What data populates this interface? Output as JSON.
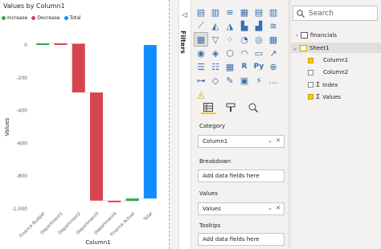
{
  "visual": {
    "title": "Values by Column1",
    "legend": [
      {
        "label": "Increase",
        "color": "#2ea84a"
      },
      {
        "label": "Decrease",
        "color": "#d64550"
      },
      {
        "label": "Total",
        "color": "#118dff"
      }
    ]
  },
  "chart_data": {
    "type": "bar",
    "subtype": "waterfall",
    "title": "Values by Column1",
    "xlabel": "Column1",
    "ylabel": "Values",
    "ylim": [
      -1000,
      0
    ],
    "yticks": [
      "0",
      "-200",
      "-400",
      "-600",
      "-800",
      "-1,000"
    ],
    "categories": [
      "Finance Budget",
      "Department1",
      "Department2",
      "Department3",
      "Department4",
      "Finance Actual",
      "Total"
    ],
    "steps": [
      {
        "category": "Finance Budget",
        "start": 0,
        "end": 10,
        "kind": "Increase"
      },
      {
        "category": "Department1",
        "start": 10,
        "end": 8,
        "kind": "Decrease"
      },
      {
        "category": "Department2",
        "start": 8,
        "end": -290,
        "kind": "Decrease"
      },
      {
        "category": "Department3",
        "start": -290,
        "end": -950,
        "kind": "Decrease"
      },
      {
        "category": "Department4",
        "start": -950,
        "end": -952,
        "kind": "Decrease"
      },
      {
        "category": "Finance Actual",
        "start": -952,
        "end": -937,
        "kind": "Increase"
      },
      {
        "category": "Total",
        "start": 0,
        "end": -937,
        "kind": "Total"
      }
    ],
    "colors": {
      "Increase": "#2ea84a",
      "Decrease": "#d64550",
      "Total": "#118dff"
    }
  },
  "filters": {
    "label": "Filters"
  },
  "visualizations": {
    "icons": [
      "stacked-bar-icon",
      "stacked-column-icon",
      "clustered-bar-icon",
      "clustered-column-icon",
      "100-bar-icon",
      "100-column-icon",
      "line-icon",
      "area-icon",
      "stacked-area-icon",
      "line-column-icon",
      "line-clustered-icon",
      "ribbon-icon",
      "waterfall-icon",
      "funnel-icon",
      "scatter-icon",
      "pie-icon",
      "donut-icon",
      "treemap-icon",
      "map-icon",
      "filled-map-icon",
      "shape-map-icon",
      "gauge-icon",
      "card-icon",
      "kpi-icon",
      "multirow-card-icon",
      "slicer-icon",
      "table-icon",
      "r-script-icon",
      "python-icon",
      "key-influencers-icon",
      "decomposition-tree-icon",
      "qa-icon",
      "smart-narrative-icon",
      "paginated-icon",
      "power-apps-icon",
      "more-icon",
      "arcgis-icon"
    ],
    "tabs": [
      "fields-tab-icon",
      "format-tab-icon",
      "analytics-tab-icon"
    ],
    "wells": {
      "category_label": "Category",
      "category_value": "Column1",
      "breakdown_label": "Breakdown",
      "breakdown_placeholder": "Add data fields here",
      "values_label": "Values",
      "values_value": "Values",
      "tooltips_label": "Tooltips",
      "tooltips_placeholder": "Add data fields here"
    }
  },
  "fields": {
    "search_placeholder": "Search",
    "tables": [
      {
        "name": "financials",
        "expanded": false
      },
      {
        "name": "Sheet1",
        "expanded": true,
        "checked": true,
        "columns": [
          {
            "name": "Column1",
            "checked": true,
            "sigma": false
          },
          {
            "name": "Column2",
            "checked": false,
            "sigma": false
          },
          {
            "name": "Index",
            "checked": false,
            "sigma": true
          },
          {
            "name": "Values",
            "checked": true,
            "sigma": true
          }
        ]
      }
    ]
  }
}
